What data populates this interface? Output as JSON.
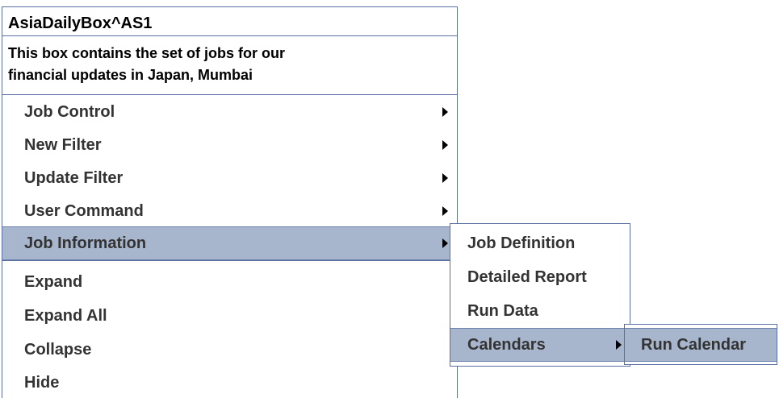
{
  "context_menu": {
    "title": "AsiaDailyBox^AS1",
    "description_lines": [
      "This box contains the set of jobs for our",
      "financial updates in Japan, Mumbai"
    ],
    "items": [
      {
        "label": "Job Control",
        "has_submenu": true
      },
      {
        "label": "New Filter",
        "has_submenu": true
      },
      {
        "label": "Update Filter",
        "has_submenu": true
      },
      {
        "label": "User Command",
        "has_submenu": true
      },
      {
        "label": "Job Information",
        "has_submenu": true,
        "highlighted": true
      },
      {
        "label": "Expand"
      },
      {
        "label": "Expand All"
      },
      {
        "label": "Collapse"
      },
      {
        "label": "Hide"
      }
    ]
  },
  "job_information_submenu": {
    "items": [
      {
        "label": "Job Definition"
      },
      {
        "label": "Detailed Report"
      },
      {
        "label": "Run Data"
      },
      {
        "label": "Calendars",
        "has_submenu": true,
        "highlighted": true
      }
    ]
  },
  "calendars_submenu": {
    "items": [
      {
        "label": "Run Calendar",
        "highlighted": true
      }
    ]
  },
  "colors": {
    "highlight_background": "#a7b6cd",
    "menu_border": "#5b6fa5",
    "background": "#ffffff"
  },
  "icons": {
    "submenu_indicator": "caret-right-icon"
  }
}
